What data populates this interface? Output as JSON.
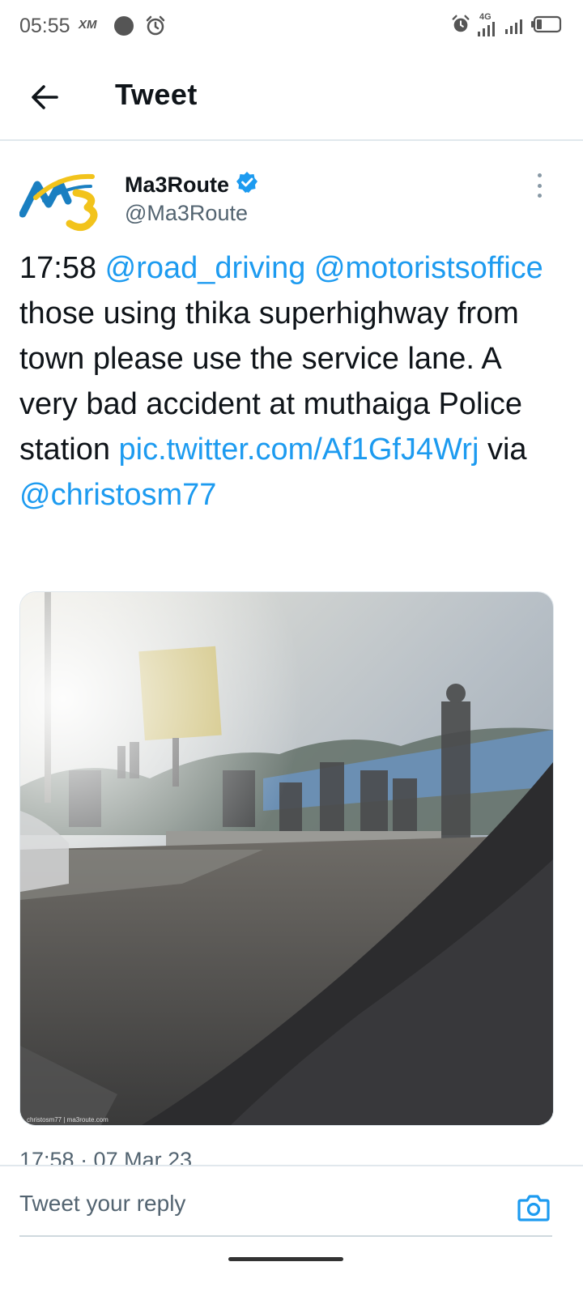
{
  "status_bar": {
    "time": "05:55",
    "carrier_badge": "XM",
    "network": "4G",
    "icons": [
      "record-dot-icon",
      "alarm-icon",
      "signal-icon",
      "battery-icon"
    ]
  },
  "header": {
    "title": "Tweet",
    "back_icon": "arrow-left-icon"
  },
  "tweet": {
    "author_name": "Ma3Route",
    "author_handle": "@Ma3Route",
    "verified": true,
    "text_segments": [
      {
        "text": "17:58 ",
        "type": "text"
      },
      {
        "text": "@road_driving",
        "type": "mention"
      },
      {
        "text": " ",
        "type": "text"
      },
      {
        "text": "@motoristsoffice",
        "type": "mention"
      },
      {
        "text": " those using thika superhighway from town please use the service lane. A very bad accident at muthaiga Police station  ",
        "type": "text"
      },
      {
        "text": "pic.twitter.com/Af1GfJ4Wrj",
        "type": "link"
      },
      {
        "text": " via ",
        "type": "text"
      },
      {
        "text": "@christosm77",
        "type": "mention"
      }
    ],
    "media_watermark": "christosm77 | ma3route.com",
    "timestamp": "17:58 · 07 Mar 23"
  },
  "reply": {
    "placeholder": "Tweet your reply",
    "camera_icon": "camera-icon"
  },
  "colors": {
    "link": "#1d9bf0",
    "text": "#0f1419",
    "secondary": "#536471",
    "verified": "#1d9bf0",
    "logo_blue": "#1a7fc1",
    "logo_yellow": "#f2c31b"
  }
}
